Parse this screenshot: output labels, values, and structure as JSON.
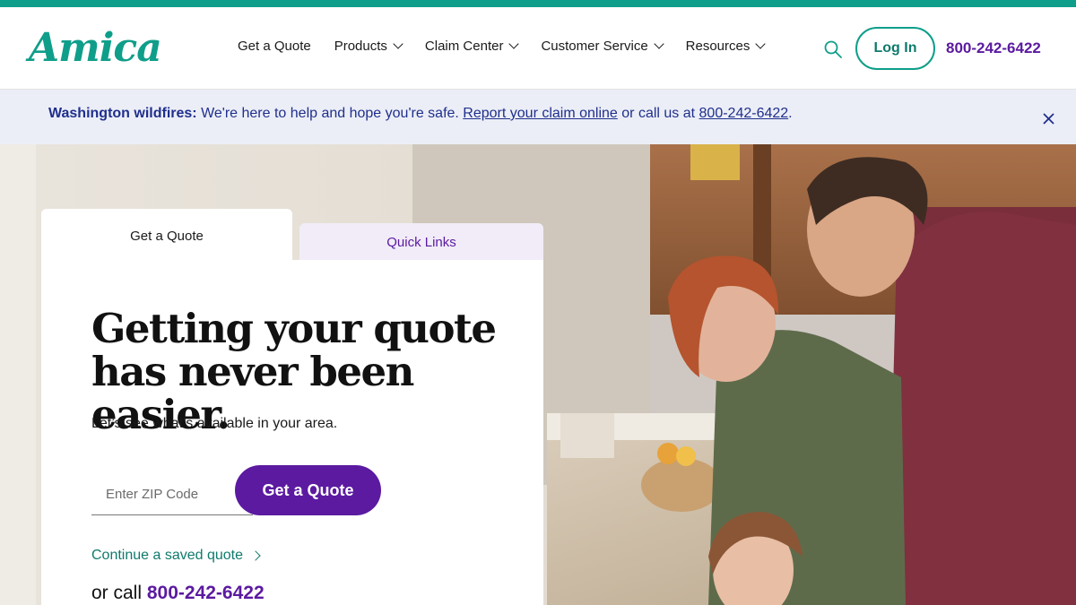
{
  "brand": {
    "logo_text": "Amica",
    "accent_color": "#0f9e8a",
    "purple_color": "#5b1aa0"
  },
  "header": {
    "nav": [
      {
        "label": "Get a Quote",
        "has_dropdown": false
      },
      {
        "label": "Products",
        "has_dropdown": true
      },
      {
        "label": "Claim Center",
        "has_dropdown": true
      },
      {
        "label": "Customer Service",
        "has_dropdown": true
      },
      {
        "label": "Resources",
        "has_dropdown": true
      }
    ],
    "search_icon": "search-icon",
    "login_label": "Log In",
    "phone": "800-242-6422"
  },
  "alert": {
    "title": "Washington wildfires:",
    "message": " We're here to help and hope you're safe. ",
    "link_text": "Report your claim online",
    "middle": " or call us at ",
    "phone_link": "800-242-6422",
    "end": ".",
    "close_icon": "close-icon"
  },
  "quote_card": {
    "tabs": {
      "quote": "Get a Quote",
      "links": "Quick Links"
    },
    "headline_line1": "Getting your quote",
    "headline_line2": "has never been easier.",
    "subtext": "Let’s see what’s available in your area.",
    "zip_placeholder": "Enter ZIP Code",
    "zip_value": "",
    "button_label": "Get a Quote",
    "saved_quote_label": "Continue a saved quote",
    "call_prefix": "or call ",
    "call_phone": "800-242-6422"
  }
}
